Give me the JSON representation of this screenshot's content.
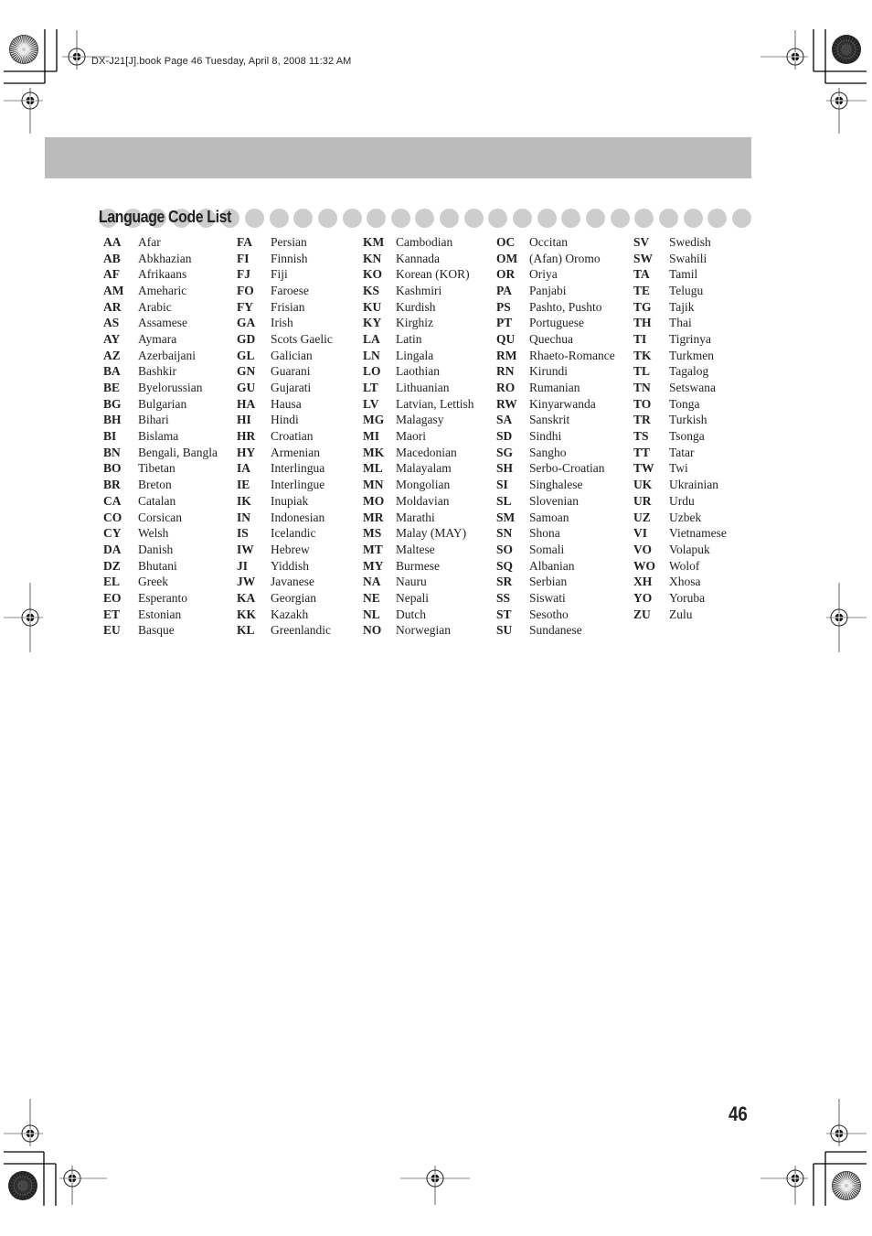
{
  "header": {
    "file_info": "DX-J21[J].book  Page 46  Tuesday, April 8, 2008  11:32 AM"
  },
  "section": {
    "title": "Language Code List"
  },
  "page_number": "46",
  "columns": [
    {
      "entries": [
        {
          "code": "AA",
          "language": "Afar"
        },
        {
          "code": "AB",
          "language": "Abkhazian"
        },
        {
          "code": "AF",
          "language": "Afrikaans"
        },
        {
          "code": "AM",
          "language": "Ameharic"
        },
        {
          "code": "AR",
          "language": "Arabic"
        },
        {
          "code": "AS",
          "language": "Assamese"
        },
        {
          "code": "AY",
          "language": "Aymara"
        },
        {
          "code": "AZ",
          "language": "Azerbaijani"
        },
        {
          "code": "BA",
          "language": "Bashkir"
        },
        {
          "code": "BE",
          "language": "Byelorussian"
        },
        {
          "code": "BG",
          "language": "Bulgarian"
        },
        {
          "code": "BH",
          "language": "Bihari"
        },
        {
          "code": "BI",
          "language": "Bislama"
        },
        {
          "code": "BN",
          "language": "Bengali, Bangla"
        },
        {
          "code": "BO",
          "language": "Tibetan"
        },
        {
          "code": "BR",
          "language": "Breton"
        },
        {
          "code": "CA",
          "language": "Catalan"
        },
        {
          "code": "CO",
          "language": "Corsican"
        },
        {
          "code": "CY",
          "language": "Welsh"
        },
        {
          "code": "DA",
          "language": "Danish"
        },
        {
          "code": "DZ",
          "language": "Bhutani"
        },
        {
          "code": "EL",
          "language": "Greek"
        },
        {
          "code": "EO",
          "language": "Esperanto"
        },
        {
          "code": "ET",
          "language": "Estonian"
        },
        {
          "code": "EU",
          "language": "Basque"
        }
      ]
    },
    {
      "entries": [
        {
          "code": "FA",
          "language": "Persian"
        },
        {
          "code": "FI",
          "language": "Finnish"
        },
        {
          "code": "FJ",
          "language": "Fiji"
        },
        {
          "code": "FO",
          "language": "Faroese"
        },
        {
          "code": "FY",
          "language": "Frisian"
        },
        {
          "code": "GA",
          "language": "Irish"
        },
        {
          "code": "GD",
          "language": "Scots Gaelic"
        },
        {
          "code": "GL",
          "language": "Galician"
        },
        {
          "code": "GN",
          "language": "Guarani"
        },
        {
          "code": "GU",
          "language": "Gujarati"
        },
        {
          "code": "HA",
          "language": "Hausa"
        },
        {
          "code": "HI",
          "language": "Hindi"
        },
        {
          "code": "HR",
          "language": "Croatian"
        },
        {
          "code": "HY",
          "language": "Armenian"
        },
        {
          "code": "IA",
          "language": "Interlingua"
        },
        {
          "code": "IE",
          "language": "Interlingue"
        },
        {
          "code": "IK",
          "language": "Inupiak"
        },
        {
          "code": "IN",
          "language": "Indonesian"
        },
        {
          "code": "IS",
          "language": "Icelandic"
        },
        {
          "code": "IW",
          "language": "Hebrew"
        },
        {
          "code": "JI",
          "language": "Yiddish"
        },
        {
          "code": "JW",
          "language": "Javanese"
        },
        {
          "code": "KA",
          "language": "Georgian"
        },
        {
          "code": "KK",
          "language": "Kazakh"
        },
        {
          "code": "KL",
          "language": "Greenlandic"
        }
      ]
    },
    {
      "entries": [
        {
          "code": "KM",
          "language": "Cambodian"
        },
        {
          "code": "KN",
          "language": "Kannada"
        },
        {
          "code": "KO",
          "language": "Korean (KOR)"
        },
        {
          "code": "KS",
          "language": "Kashmiri"
        },
        {
          "code": "KU",
          "language": "Kurdish"
        },
        {
          "code": "KY",
          "language": "Kirghiz"
        },
        {
          "code": "LA",
          "language": "Latin"
        },
        {
          "code": "LN",
          "language": "Lingala"
        },
        {
          "code": "LO",
          "language": "Laothian"
        },
        {
          "code": "LT",
          "language": "Lithuanian"
        },
        {
          "code": "LV",
          "language": "Latvian, Lettish"
        },
        {
          "code": "MG",
          "language": "Malagasy"
        },
        {
          "code": "MI",
          "language": "Maori"
        },
        {
          "code": "MK",
          "language": "Macedonian"
        },
        {
          "code": "ML",
          "language": "Malayalam"
        },
        {
          "code": "MN",
          "language": "Mongolian"
        },
        {
          "code": "MO",
          "language": "Moldavian"
        },
        {
          "code": "MR",
          "language": "Marathi"
        },
        {
          "code": "MS",
          "language": "Malay (MAY)"
        },
        {
          "code": "MT",
          "language": "Maltese"
        },
        {
          "code": "MY",
          "language": "Burmese"
        },
        {
          "code": "NA",
          "language": "Nauru"
        },
        {
          "code": "NE",
          "language": "Nepali"
        },
        {
          "code": "NL",
          "language": "Dutch"
        },
        {
          "code": "NO",
          "language": "Norwegian"
        }
      ]
    },
    {
      "entries": [
        {
          "code": "OC",
          "language": "Occitan"
        },
        {
          "code": "OM",
          "language": "(Afan) Oromo"
        },
        {
          "code": "OR",
          "language": "Oriya"
        },
        {
          "code": "PA",
          "language": "Panjabi"
        },
        {
          "code": "PS",
          "language": "Pashto, Pushto"
        },
        {
          "code": "PT",
          "language": "Portuguese"
        },
        {
          "code": "QU",
          "language": "Quechua"
        },
        {
          "code": "RM",
          "language": "Rhaeto-Romance"
        },
        {
          "code": "RN",
          "language": "Kirundi"
        },
        {
          "code": "RO",
          "language": "Rumanian"
        },
        {
          "code": "RW",
          "language": "Kinyarwanda"
        },
        {
          "code": "SA",
          "language": "Sanskrit"
        },
        {
          "code": "SD",
          "language": "Sindhi"
        },
        {
          "code": "SG",
          "language": "Sangho"
        },
        {
          "code": "SH",
          "language": "Serbo-Croatian"
        },
        {
          "code": "SI",
          "language": "Singhalese"
        },
        {
          "code": "SL",
          "language": "Slovenian"
        },
        {
          "code": "SM",
          "language": "Samoan"
        },
        {
          "code": "SN",
          "language": "Shona"
        },
        {
          "code": "SO",
          "language": "Somali"
        },
        {
          "code": "SQ",
          "language": "Albanian"
        },
        {
          "code": "SR",
          "language": "Serbian"
        },
        {
          "code": "SS",
          "language": "Siswati"
        },
        {
          "code": "ST",
          "language": "Sesotho"
        },
        {
          "code": "SU",
          "language": "Sundanese"
        }
      ]
    },
    {
      "entries": [
        {
          "code": "SV",
          "language": "Swedish"
        },
        {
          "code": "SW",
          "language": "Swahili"
        },
        {
          "code": "TA",
          "language": "Tamil"
        },
        {
          "code": "TE",
          "language": "Telugu"
        },
        {
          "code": "TG",
          "language": "Tajik"
        },
        {
          "code": "TH",
          "language": "Thai"
        },
        {
          "code": "TI",
          "language": "Tigrinya"
        },
        {
          "code": "TK",
          "language": "Turkmen"
        },
        {
          "code": "TL",
          "language": "Tagalog"
        },
        {
          "code": "TN",
          "language": "Setswana"
        },
        {
          "code": "TO",
          "language": "Tonga"
        },
        {
          "code": "TR",
          "language": "Turkish"
        },
        {
          "code": "TS",
          "language": "Tsonga"
        },
        {
          "code": "TT",
          "language": "Tatar"
        },
        {
          "code": "TW",
          "language": "Twi"
        },
        {
          "code": "UK",
          "language": "Ukrainian"
        },
        {
          "code": "UR",
          "language": "Urdu"
        },
        {
          "code": "UZ",
          "language": "Uzbek"
        },
        {
          "code": "VI",
          "language": "Vietnamese"
        },
        {
          "code": "VO",
          "language": "Volapuk"
        },
        {
          "code": "WO",
          "language": "Wolof"
        },
        {
          "code": "XH",
          "language": "Xhosa"
        },
        {
          "code": "YO",
          "language": "Yoruba"
        },
        {
          "code": "ZU",
          "language": "Zulu"
        }
      ]
    }
  ],
  "colors": {
    "band": "#bbbbbb",
    "dots": "#cdcdcd",
    "text": "#231f20"
  }
}
